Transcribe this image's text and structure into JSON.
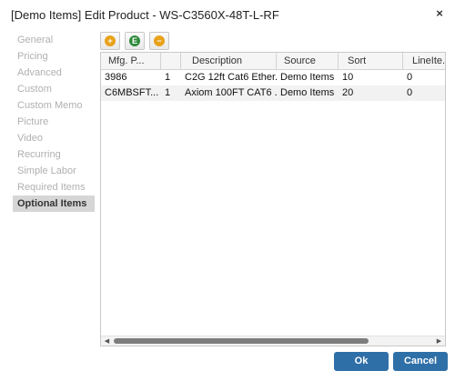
{
  "dialog": {
    "title": "[Demo Items] Edit Product - WS-C3560X-48T-L-RF",
    "close_glyph": "×"
  },
  "sidebar": {
    "items": [
      {
        "label": "General",
        "active": false
      },
      {
        "label": "Pricing",
        "active": false
      },
      {
        "label": "Advanced",
        "active": false
      },
      {
        "label": "Custom",
        "active": false
      },
      {
        "label": "Custom Memo",
        "active": false
      },
      {
        "label": "Picture",
        "active": false
      },
      {
        "label": "Video",
        "active": false
      },
      {
        "label": "Recurring",
        "active": false
      },
      {
        "label": "Simple Labor",
        "active": false
      },
      {
        "label": "Required Items",
        "active": false
      },
      {
        "label": "Optional Items",
        "active": true
      }
    ]
  },
  "toolbar": {
    "add": {
      "icon": "add-icon",
      "glyph": "+",
      "color": "#e8a21b"
    },
    "edit": {
      "icon": "edit-icon",
      "glyph": "E",
      "color": "#2e8b3a"
    },
    "remove": {
      "icon": "remove-icon",
      "glyph": "−",
      "color": "#e8a21b"
    }
  },
  "grid": {
    "columns": [
      "Mfg. P...",
      "",
      "Description",
      "Source",
      "Sort",
      "LineIte..."
    ],
    "rows": [
      [
        "3986",
        "1",
        "C2G 12ft Cat6 Ether...",
        "Demo Items",
        "10",
        "0"
      ],
      [
        "C6MBSFT...",
        "1",
        "Axiom 100FT CAT6 ...",
        "Demo Items",
        "20",
        "0"
      ]
    ],
    "scroll_left": "◀",
    "scroll_right": "▶"
  },
  "buttons": {
    "ok": "Ok",
    "cancel": "Cancel"
  },
  "colors": {
    "primary_button": "#2f6fa8",
    "active_nav": "#d6d6d6"
  }
}
